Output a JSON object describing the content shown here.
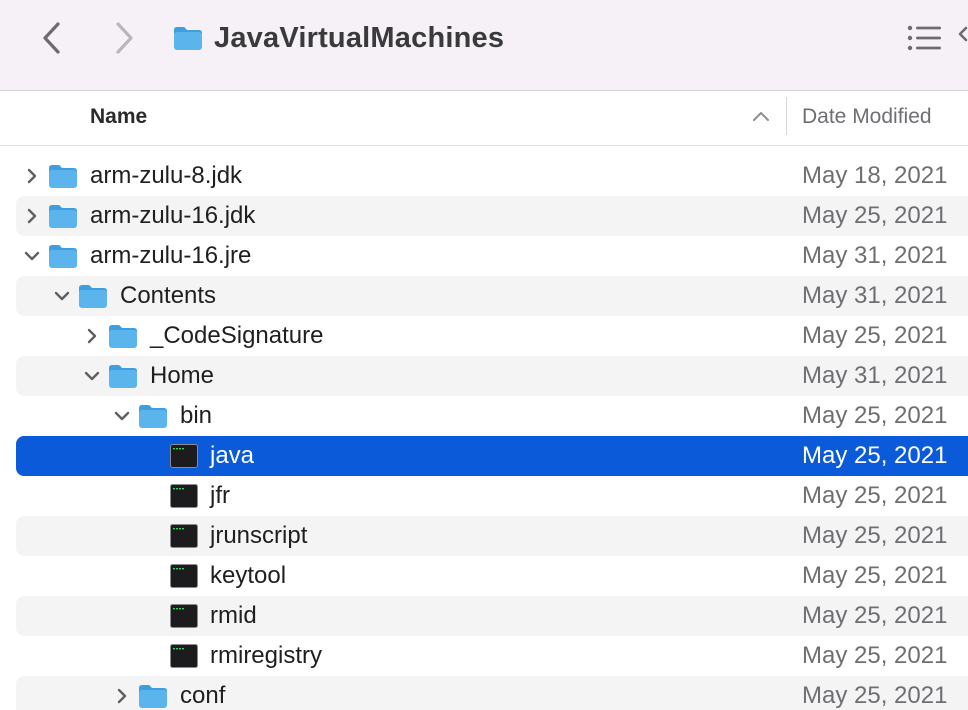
{
  "window": {
    "title": "JavaVirtualMachines"
  },
  "toolbar": {
    "back_icon": "chevron-left-icon",
    "forward_icon": "chevron-right-icon",
    "folder_icon": "folder-icon",
    "view_icon": "list-view-icon"
  },
  "columns": {
    "name": "Name",
    "date": "Date Modified",
    "sort": "ascending"
  },
  "colors": {
    "selection": "#0a5ad9",
    "folder": "#5bb5ec",
    "alt_row": "#f4f4f5"
  },
  "rows": [
    {
      "name": "arm-zulu-8.jdk",
      "date": "May 18, 2021",
      "kind": "folder",
      "depth": 0,
      "disclosure": "collapsed",
      "selected": false
    },
    {
      "name": "arm-zulu-16.jdk",
      "date": "May 25, 2021",
      "kind": "folder",
      "depth": 0,
      "disclosure": "collapsed",
      "selected": false
    },
    {
      "name": "arm-zulu-16.jre",
      "date": "May 31, 2021",
      "kind": "folder",
      "depth": 0,
      "disclosure": "expanded",
      "selected": false
    },
    {
      "name": "Contents",
      "date": "May 31, 2021",
      "kind": "folder",
      "depth": 1,
      "disclosure": "expanded",
      "selected": false
    },
    {
      "name": "_CodeSignature",
      "date": "May 25, 2021",
      "kind": "folder",
      "depth": 2,
      "disclosure": "collapsed",
      "selected": false
    },
    {
      "name": "Home",
      "date": "May 31, 2021",
      "kind": "folder",
      "depth": 2,
      "disclosure": "expanded",
      "selected": false
    },
    {
      "name": "bin",
      "date": "May 25, 2021",
      "kind": "folder",
      "depth": 3,
      "disclosure": "expanded",
      "selected": false
    },
    {
      "name": "java",
      "date": "May 25, 2021",
      "kind": "exec",
      "depth": 4,
      "disclosure": "none",
      "selected": true
    },
    {
      "name": "jfr",
      "date": "May 25, 2021",
      "kind": "exec",
      "depth": 4,
      "disclosure": "none",
      "selected": false
    },
    {
      "name": "jrunscript",
      "date": "May 25, 2021",
      "kind": "exec",
      "depth": 4,
      "disclosure": "none",
      "selected": false
    },
    {
      "name": "keytool",
      "date": "May 25, 2021",
      "kind": "exec",
      "depth": 4,
      "disclosure": "none",
      "selected": false
    },
    {
      "name": "rmid",
      "date": "May 25, 2021",
      "kind": "exec",
      "depth": 4,
      "disclosure": "none",
      "selected": false
    },
    {
      "name": "rmiregistry",
      "date": "May 25, 2021",
      "kind": "exec",
      "depth": 4,
      "disclosure": "none",
      "selected": false
    },
    {
      "name": "conf",
      "date": "May 25, 2021",
      "kind": "folder",
      "depth": 3,
      "disclosure": "collapsed",
      "selected": false
    }
  ]
}
